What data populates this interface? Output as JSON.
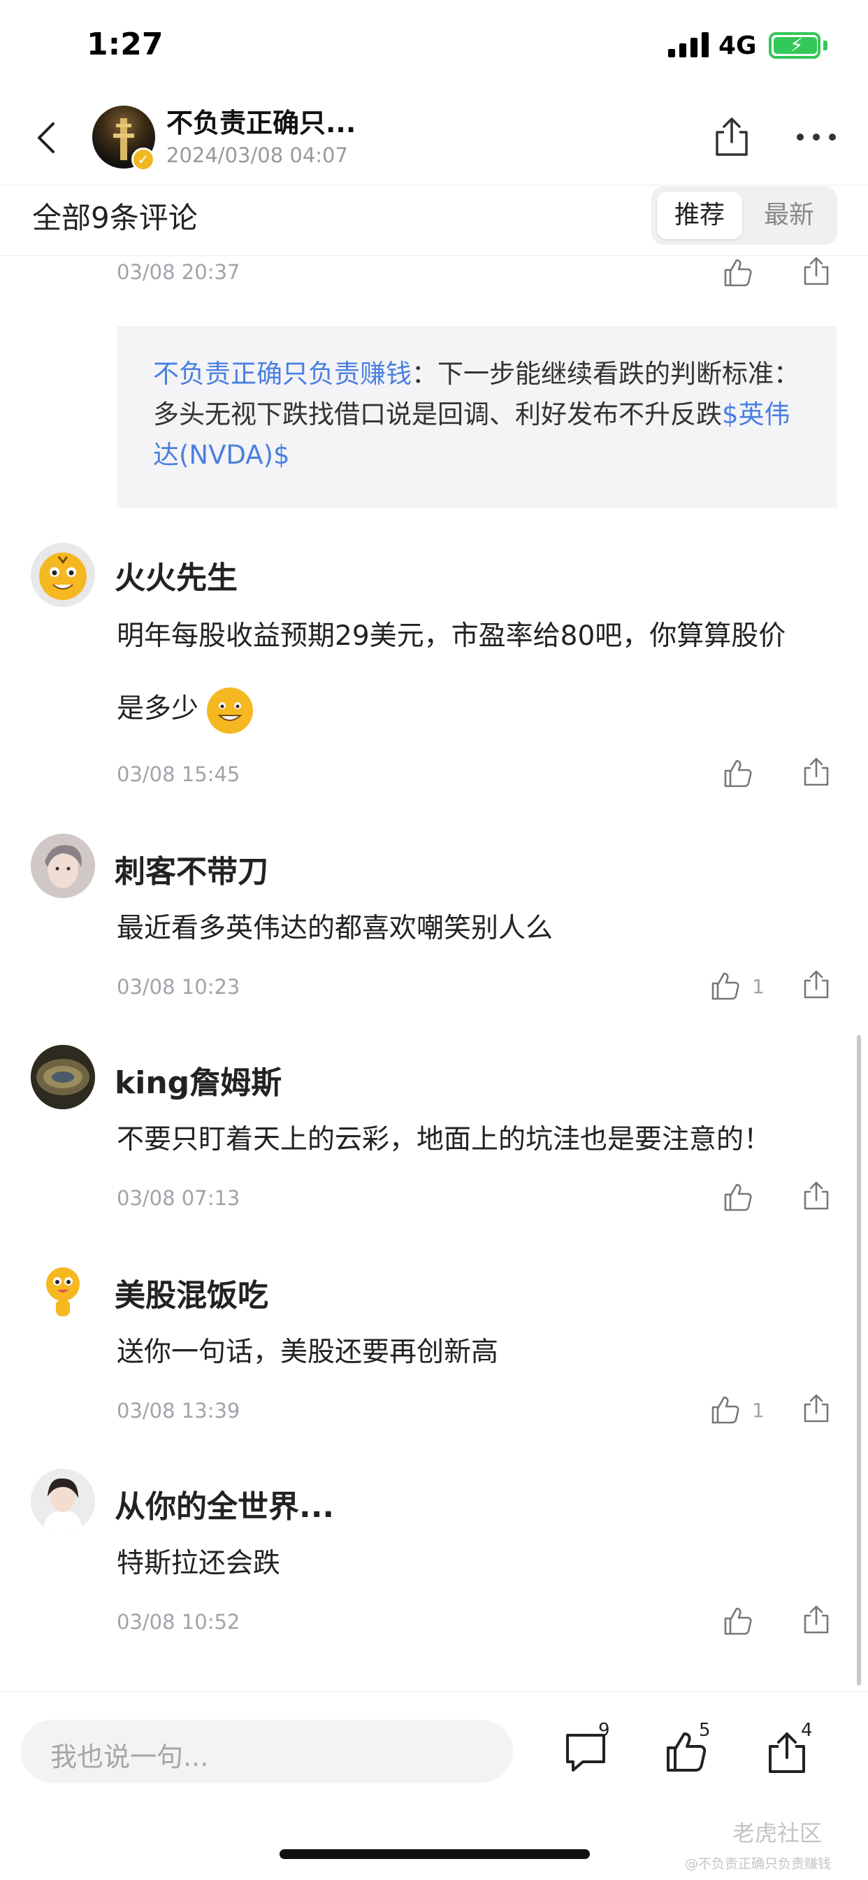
{
  "status_bar": {
    "time": "1:27",
    "network": "4G"
  },
  "header": {
    "author_name": "不负责正确只...",
    "post_time": "2024/03/08 04:07"
  },
  "comments_header": {
    "count_label": "全部9条评论",
    "sort_recommended": "推荐",
    "sort_latest": "最新"
  },
  "top_comment": {
    "date": "03/08 20:37"
  },
  "reply": {
    "author": "不负责正确只负责赚钱",
    "separator": "：",
    "text": "下一步能继续看跌的判断标准：多头无视下跌找借口说是回调、利好发布不升反跌",
    "stock_tag": "$英伟达(NVDA)$"
  },
  "comments": [
    {
      "username": "火火先生",
      "text_line1": "明年每股收益预期29美元，市盈率给80吧，你算算股价",
      "text_line2": "是多少",
      "date": "03/08 15:45",
      "likes": ""
    },
    {
      "username": "刺客不带刀",
      "text": "最近看多英伟达的都喜欢嘲笑别人么",
      "date": "03/08 10:23",
      "likes": "1"
    },
    {
      "username": "king詹姆斯",
      "text": "不要只盯着天上的云彩，地面上的坑洼也是要注意的！",
      "date": "03/08 07:13",
      "likes": ""
    },
    {
      "username": "美股混饭吃",
      "text": "送你一句话，美股还要再创新高",
      "date": "03/08 13:39",
      "likes": "1"
    },
    {
      "username": "从你的全世界...",
      "text": "特斯拉还会跌",
      "date": "03/08 10:52",
      "likes": ""
    }
  ],
  "bottom_bar": {
    "input_placeholder": "我也说一句...",
    "comment_count": "9",
    "like_count": "5",
    "share_count": "4"
  },
  "watermark": {
    "brand": "老虎社区",
    "sub": "@不负责正确只负责赚钱"
  },
  "colors": {
    "link": "#4a7fe0",
    "muted": "#a0a4aa",
    "battery": "#34c759"
  }
}
